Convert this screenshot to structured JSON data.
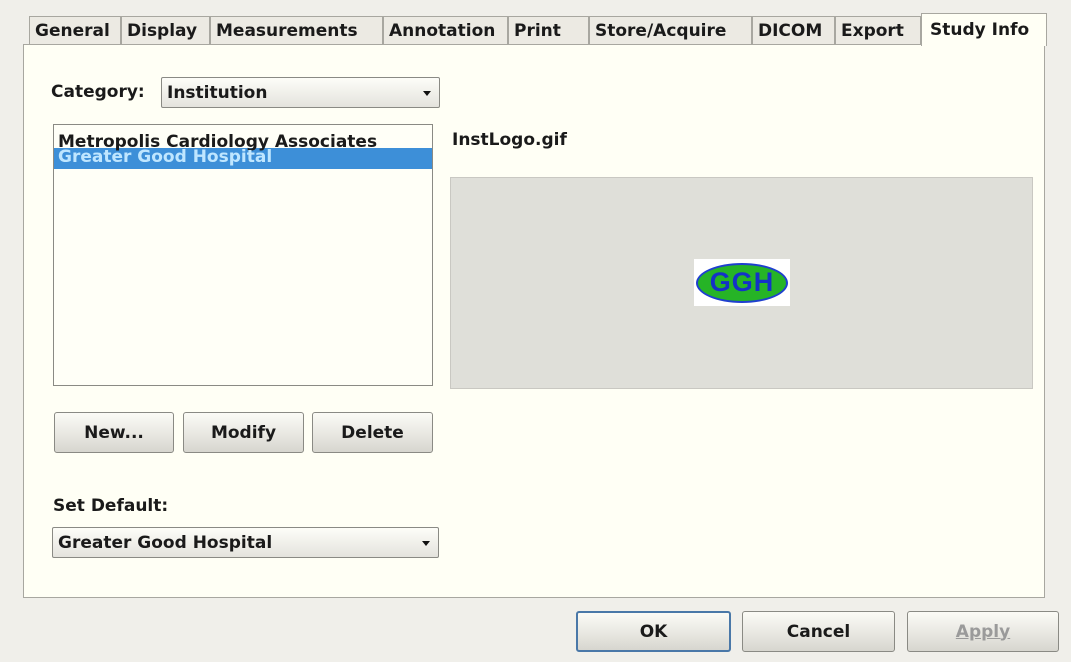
{
  "tabs": [
    {
      "label": "General"
    },
    {
      "label": "Display"
    },
    {
      "label": "Measurements"
    },
    {
      "label": "Annotation"
    },
    {
      "label": "Print"
    },
    {
      "label": "Store/Acquire"
    },
    {
      "label": "DICOM"
    },
    {
      "label": "Export"
    },
    {
      "label": "Study Info",
      "active": true
    }
  ],
  "category": {
    "label": "Category:",
    "value": "Institution"
  },
  "institutions": {
    "items": [
      "Metropolis Cardiology Associates",
      "Greater Good Hospital"
    ],
    "selected_index": 1
  },
  "logo": {
    "filename": "InstLogo.gif",
    "text": "GGH",
    "fill": "#26b426",
    "text_color": "#1432c8"
  },
  "list_buttons": {
    "new": "New...",
    "modify": "Modify",
    "delete": "Delete"
  },
  "default": {
    "label": "Set Default:",
    "value": "Greater Good Hospital"
  },
  "dialog_buttons": {
    "ok": "OK",
    "cancel": "Cancel",
    "apply": "Apply"
  },
  "colors": {
    "selection": "#3d8fd8",
    "panel": "#fffff5",
    "background": "#f0efea"
  }
}
